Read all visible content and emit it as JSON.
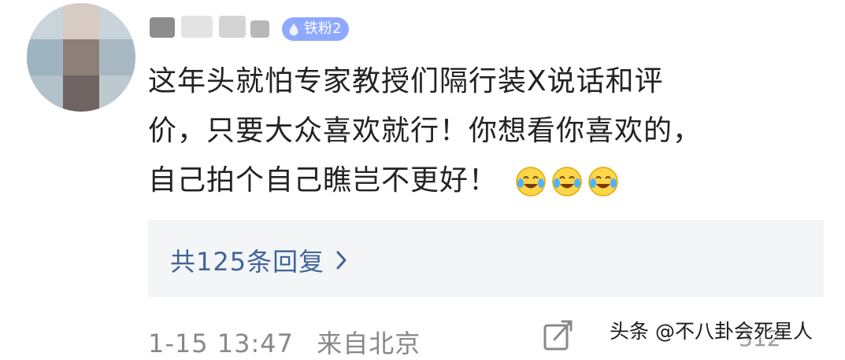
{
  "comment": {
    "badge_label": "铁粉2",
    "text_line1": "这年头就怕专家教授们隔行装X说话和评",
    "text_line2": "价，只要大众喜欢就行！你想看你喜欢的，",
    "text_line3": "自己拍个自己瞧岂不更好！",
    "emoji_names": [
      "laugh-cry-emoji",
      "laugh-cry-emoji",
      "laugh-cry-emoji"
    ]
  },
  "replies": {
    "label": "共125条回复",
    "icon": "chevron-right-icon"
  },
  "footer": {
    "timestamp": "1-15 13:47",
    "location": "来自北京",
    "share_icon": "share-icon",
    "count": "312"
  },
  "watermark": {
    "text": "头条 @不八卦会死星人"
  },
  "colors": {
    "badge_bg": "#8fa9ff",
    "reply_link": "#406599",
    "reply_box_bg": "#f4f5f7"
  }
}
